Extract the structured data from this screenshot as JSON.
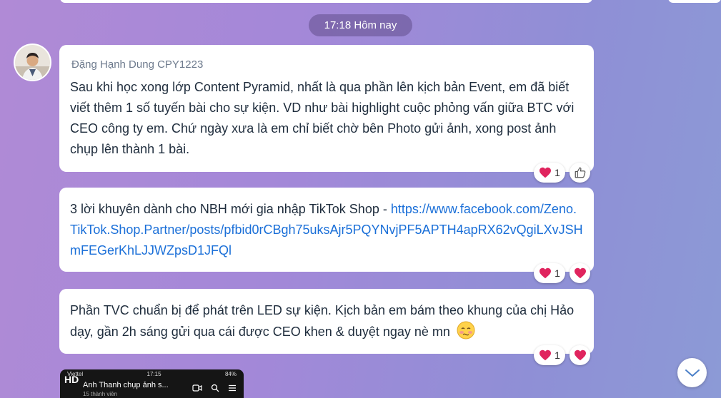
{
  "timestamp": "17:18 Hôm nay",
  "messages": [
    {
      "sender": "Đặng Hạnh Dung CPY1223",
      "text": "Sau khi học xong lớp Content Pyramid, nhất là qua phần lên kịch bản Event, em đã biết viết thêm 1 số tuyến bài cho sự kiện. VD như bài highlight cuộc phỏng vấn giữa BTC với CEO công ty em. Chứ ngày xưa là em chỉ biết chờ bên Photo gửi ảnh, xong post ảnh chụp lên thành 1 bài.",
      "reaction_count": "1",
      "reaction_emoji": "heart-icon",
      "action_icon": "thumbs-up-icon"
    },
    {
      "text_prefix": "3 lời khuyên dành cho NBH mới gia nhập TikTok Shop - ",
      "link": "https://www.facebook.com/Zeno.TikTok.Shop.Partner/posts/pfbid0rCBgh75uksAjr5PQYNvjPF5APTH4apRX62vQgiLXvJSHmFEGerKhLJJWZpsD1JFQl",
      "reaction_count": "1",
      "reaction_emoji": "heart-icon",
      "action_icon": "heart-icon"
    },
    {
      "text": "Phần TVC chuẩn bị để phát trên LED sự kiện. Kịch bản em bám theo khung của chị Hảo dạy, gần 2h sáng gửi qua cái được CEO khen & duyệt ngay nè mn",
      "emoji": "blushing-face-icon",
      "reaction_count": "1",
      "reaction_emoji": "heart-icon",
      "action_icon": "heart-icon"
    }
  ],
  "thumbnail": {
    "carrier": "Viettel",
    "clock": "17:15",
    "battery": "84%",
    "badge": "HD",
    "title": "Anh Thanh chụp ảnh s...",
    "subtitle": "15 thành viên"
  },
  "colors": {
    "link": "#1a6fd8",
    "heart": "#e0245e"
  }
}
